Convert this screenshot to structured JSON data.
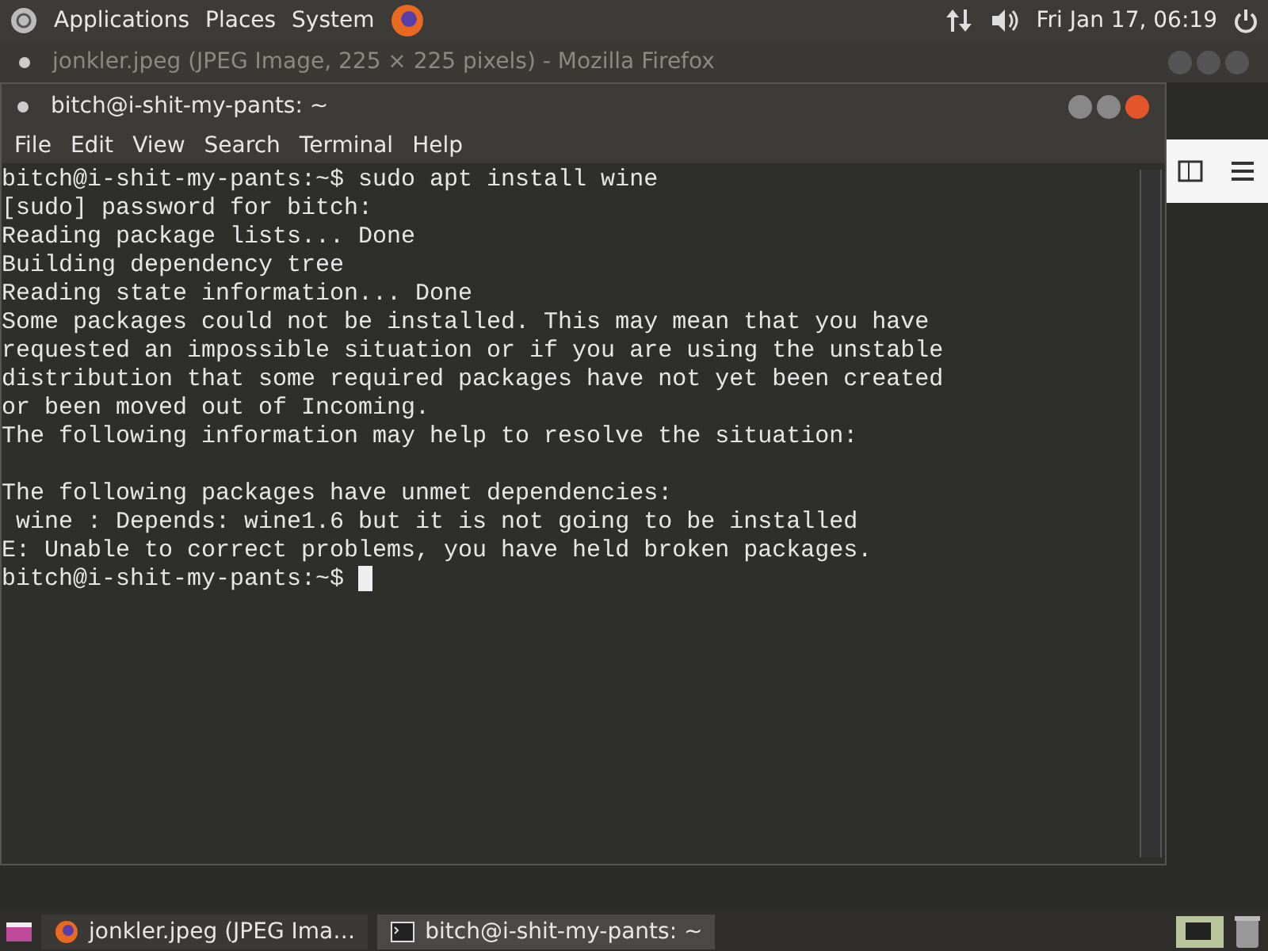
{
  "top_panel": {
    "menus": [
      "Applications",
      "Places",
      "System"
    ],
    "clock": "Fri Jan 17, 06:19"
  },
  "background_window": {
    "title": "jonkler.jpeg (JPEG Image, 225 × 225 pixels) - Mozilla Firefox"
  },
  "terminal": {
    "title": "bitch@i-shit-my-pants: ~",
    "menu": [
      "File",
      "Edit",
      "View",
      "Search",
      "Terminal",
      "Help"
    ],
    "lines": [
      "bitch@i-shit-my-pants:~$ sudo apt install wine",
      "[sudo] password for bitch:",
      "Reading package lists... Done",
      "Building dependency tree",
      "Reading state information... Done",
      "Some packages could not be installed. This may mean that you have",
      "requested an impossible situation or if you are using the unstable",
      "distribution that some required packages have not yet been created",
      "or been moved out of Incoming.",
      "The following information may help to resolve the situation:",
      "\nThe following packages have unmet dependencies:",
      " wine : Depends: wine1.6 but it is not going to be installed",
      "E: Unable to correct problems, you have held broken packages.",
      "bitch@i-shit-my-pants:~$ "
    ]
  },
  "taskbar": {
    "tasks": [
      {
        "kind": "browser",
        "label": "jonkler.jpeg (JPEG Ima…",
        "selected": false
      },
      {
        "kind": "terminal",
        "label": "bitch@i-shit-my-pants: ~",
        "selected": true
      }
    ]
  }
}
